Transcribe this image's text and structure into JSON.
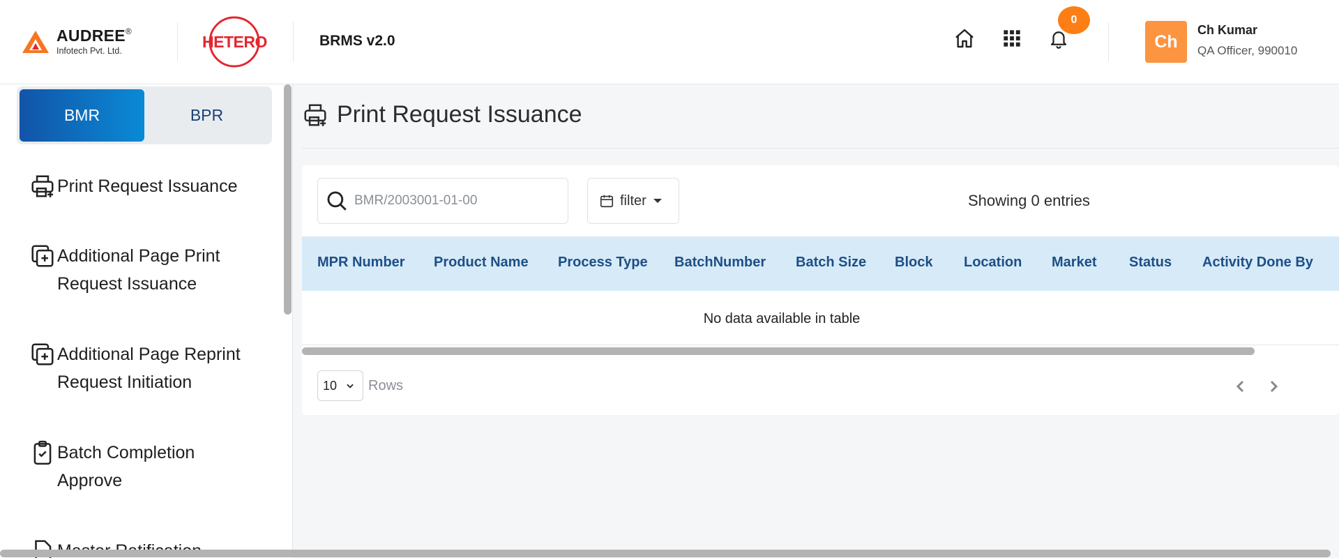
{
  "header": {
    "company_name": "AUDREE",
    "company_reg": "®",
    "company_sub": "Infotech Pvt. Ltd.",
    "client_logo_text": "HETERO",
    "app_title": "BRMS v2.0",
    "icons": [
      "home-icon",
      "apps-grid-icon",
      "bell-icon"
    ],
    "notification_count": "0",
    "avatar_initials": "Ch",
    "user_name": "Ch Kumar",
    "user_role": "QA Officer, 990010",
    "accent_color": "#fd7e14"
  },
  "sidebar": {
    "toggle": {
      "bmr_label": "BMR",
      "bpr_label": "BPR",
      "active": "BMR"
    },
    "items": [
      {
        "label": "Print Request Issuance",
        "icon": "printer-plus-icon"
      },
      {
        "label": "Additional Page Print Request Issuance",
        "icon": "copy-plus-icon"
      },
      {
        "label": "Additional Page Reprint Request Initiation",
        "icon": "copy-plus-icon"
      },
      {
        "label": "Batch Completion Approve",
        "icon": "clipboard-check-icon"
      }
    ],
    "partial_item": "Master Ratification"
  },
  "main": {
    "page_title": "Print Request Issuance",
    "search_placeholder": "BMR/2003001-01-00",
    "filter_label": "filter",
    "entries_text": "Showing 0 entries",
    "table": {
      "columns": [
        "MPR Number",
        "Product Name",
        "Process Type",
        "BatchNumber",
        "Batch Size",
        "Block",
        "Location",
        "Market",
        "Status",
        "Activity Done By"
      ],
      "rows": [],
      "empty_text": "No data available in table"
    },
    "rows_per_page": "10",
    "rows_label": "Rows"
  }
}
